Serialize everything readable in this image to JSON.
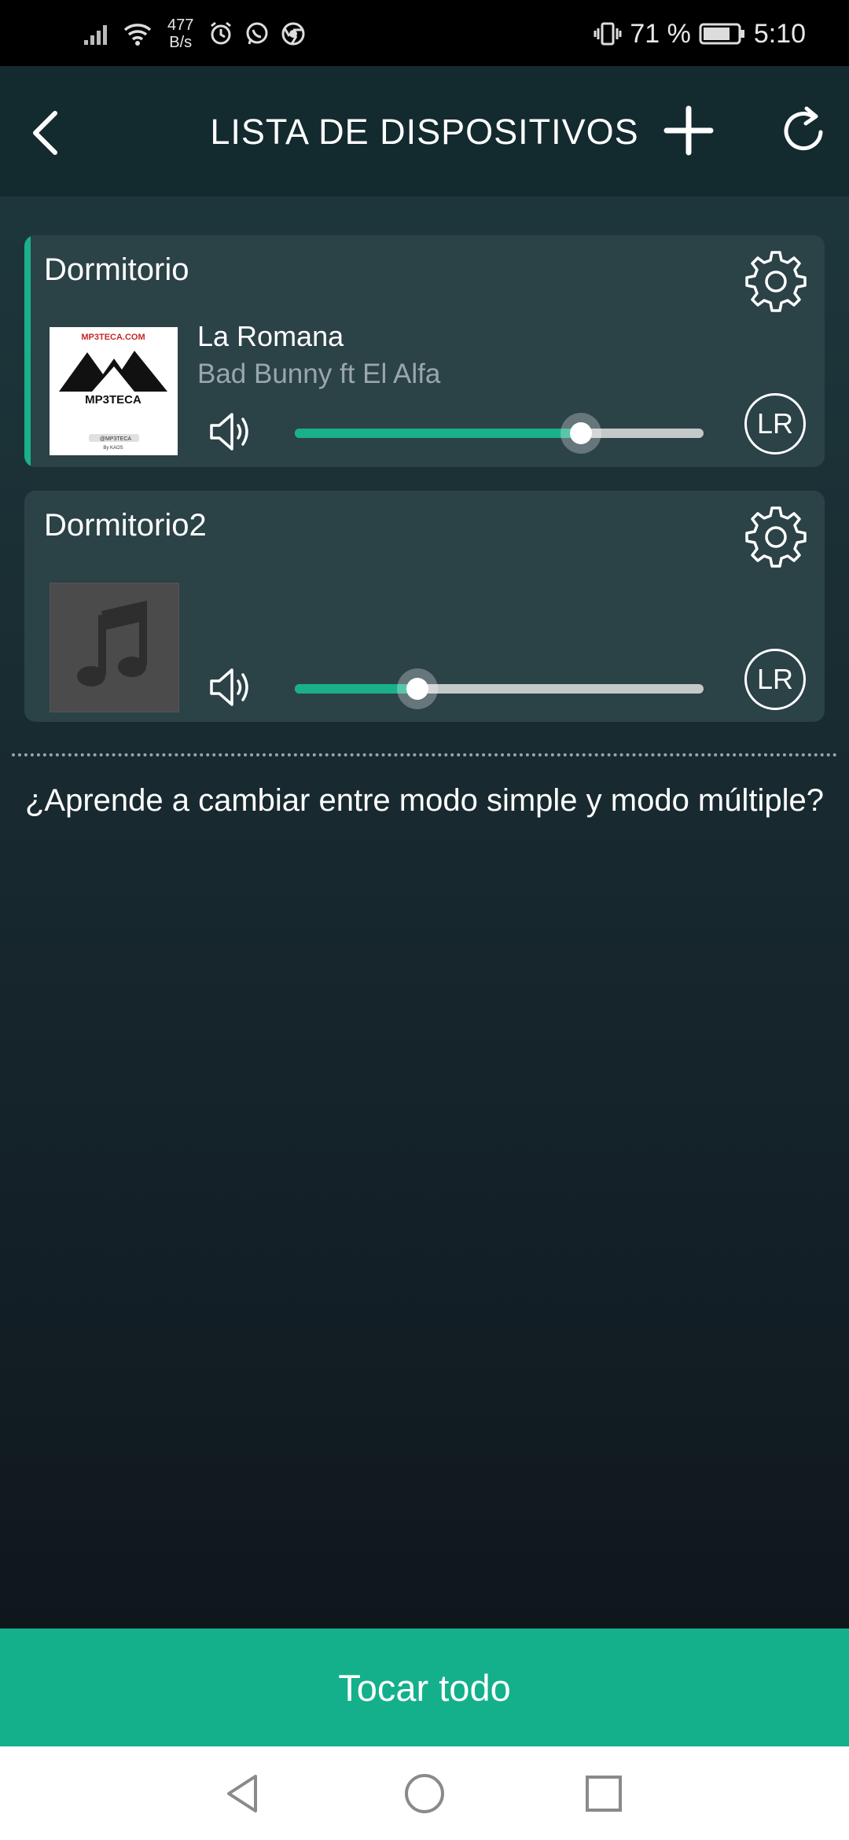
{
  "status_bar": {
    "net_speed_value": "477",
    "net_speed_unit": "B/s",
    "battery_percent": "71 %",
    "time": "5:10"
  },
  "header": {
    "title": "LISTA DE DISPOSITIVOS"
  },
  "devices": [
    {
      "name": "Dormitorio",
      "track_title": "La Romana",
      "track_artist": "Bad Bunny ft El Alfa",
      "volume_percent": 70,
      "channel": "LR",
      "artwork": {
        "site": "MP3TECA.COM",
        "brand": "MP3TECA",
        "handle": "@MP3TECA",
        "credit": "By KAOS"
      }
    },
    {
      "name": "Dormitorio2",
      "track_title": "",
      "track_artist": "",
      "volume_percent": 30,
      "channel": "LR"
    }
  ],
  "help_link": "¿Aprende a cambiar entre modo simple y modo múltiple?",
  "footer": {
    "play_all_label": "Tocar todo"
  },
  "colors": {
    "accent": "#13b08b",
    "card_bg": "#2b4247",
    "header_bg": "#132a2f"
  }
}
